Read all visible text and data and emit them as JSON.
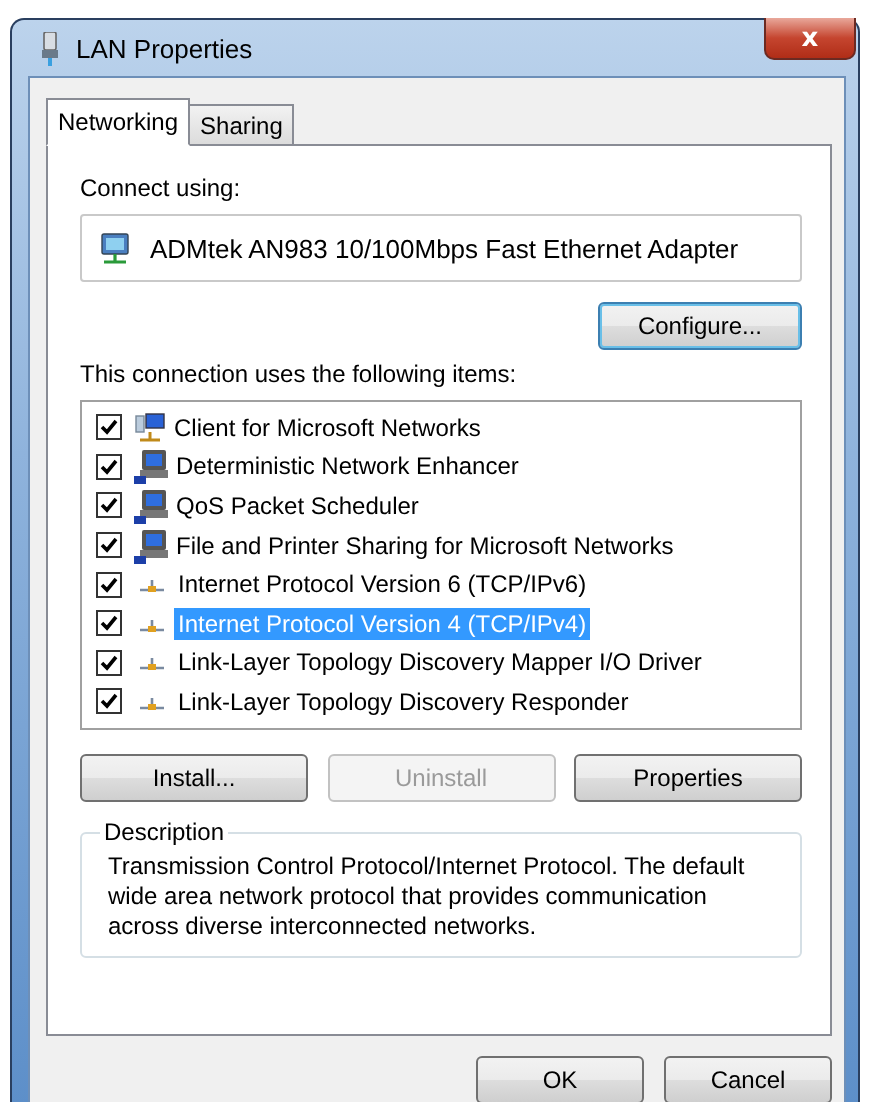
{
  "window": {
    "title": "LAN Properties",
    "close_label": "x"
  },
  "tabs": [
    {
      "label": "Networking",
      "selected": true
    },
    {
      "label": "Sharing",
      "selected": false
    }
  ],
  "connect_using": {
    "label": "Connect using:",
    "adapter": "ADMtek AN983 10/100Mbps Fast Ethernet Adapter",
    "configure_button": "Configure..."
  },
  "items_label": "This connection uses the following items:",
  "items": [
    {
      "kind": "client",
      "label": "Client for Microsoft Networks",
      "checked": true,
      "selected": false
    },
    {
      "kind": "service",
      "label": "Deterministic Network Enhancer",
      "checked": true,
      "selected": false
    },
    {
      "kind": "service",
      "label": "QoS Packet Scheduler",
      "checked": true,
      "selected": false
    },
    {
      "kind": "service",
      "label": "File and Printer Sharing for Microsoft Networks",
      "checked": true,
      "selected": false
    },
    {
      "kind": "protocol",
      "label": "Internet Protocol Version 6 (TCP/IPv6)",
      "checked": true,
      "selected": false
    },
    {
      "kind": "protocol",
      "label": "Internet Protocol Version 4 (TCP/IPv4)",
      "checked": true,
      "selected": true
    },
    {
      "kind": "protocol",
      "label": "Link-Layer Topology Discovery Mapper I/O Driver",
      "checked": true,
      "selected": false
    },
    {
      "kind": "protocol",
      "label": "Link-Layer Topology Discovery Responder",
      "checked": true,
      "selected": false
    }
  ],
  "item_buttons": [
    {
      "label": "Install...",
      "disabled": false
    },
    {
      "label": "Uninstall",
      "disabled": true
    },
    {
      "label": "Properties",
      "disabled": false
    }
  ],
  "description": {
    "title": "Description",
    "text": "Transmission Control Protocol/Internet Protocol. The default wide area network protocol that provides communication across diverse interconnected networks."
  },
  "dialog_buttons": [
    {
      "label": "OK"
    },
    {
      "label": "Cancel"
    }
  ]
}
